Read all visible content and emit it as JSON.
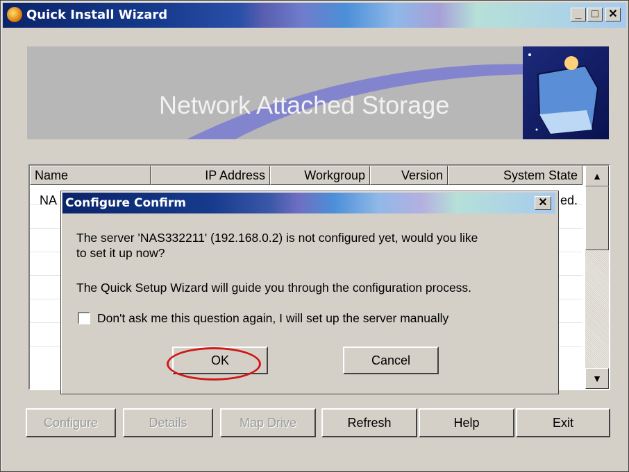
{
  "window": {
    "title": "Quick Install Wizard",
    "minimize_label": "_",
    "maximize_label": "□",
    "close_label": "✕"
  },
  "banner": {
    "title": "Network Attached Storage"
  },
  "table": {
    "columns": [
      "Name",
      "IP Address",
      "Workgroup",
      "Version",
      "System State"
    ],
    "row_fragment_name": "NA",
    "row_fragment_state": "ed.",
    "scroll_up": "▲",
    "scroll_down": "▼"
  },
  "dialog": {
    "title": "Configure Confirm",
    "close_label": "✕",
    "message_line1": "The server 'NAS332211' (192.168.0.2) is not configured yet, would  you like",
    "message_line2": "to set it up now?",
    "message_guide": "The Quick Setup Wizard will guide you through the configuration process.",
    "checkbox_label": "Don't ask me this question again, I will set up the server manually",
    "checkbox_checked": false,
    "ok_label": "OK",
    "cancel_label": "Cancel"
  },
  "buttons": {
    "configure": "Configure",
    "details": "Details",
    "map_drive": "Map Drive",
    "refresh": "Refresh",
    "help": "Help",
    "exit": "Exit"
  },
  "colors": {
    "highlight_ring": "#d01818",
    "face": "#d4d0c8"
  }
}
